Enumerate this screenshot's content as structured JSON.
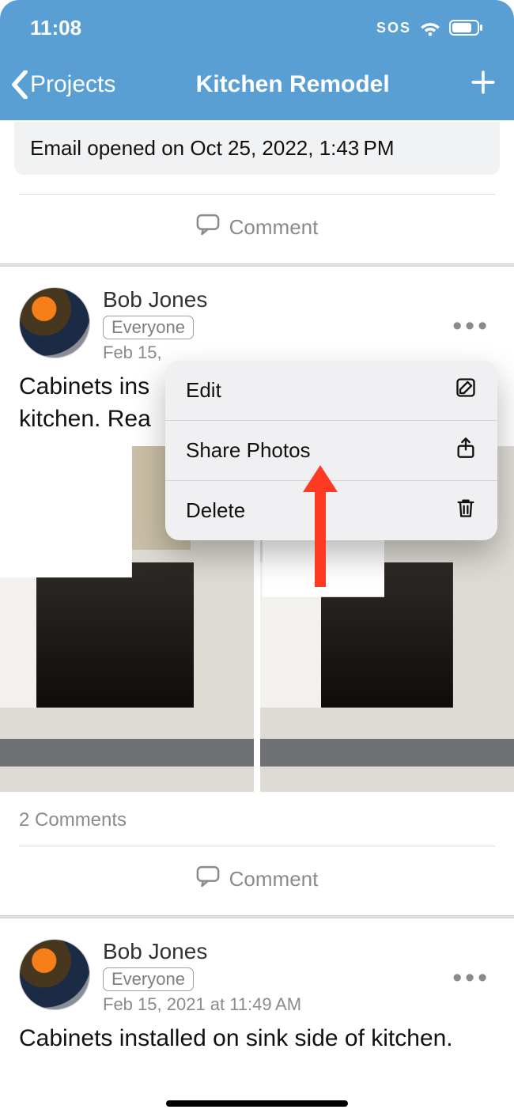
{
  "status_bar": {
    "time": "11:08",
    "sos": "SOS"
  },
  "nav": {
    "back_label": "Projects",
    "title": "Kitchen Remodel"
  },
  "email_card": {
    "text": "Email opened on Oct 25, 2022, 1:43 PM"
  },
  "comment_label": "Comment",
  "popover": {
    "items": [
      {
        "label": "Edit"
      },
      {
        "label": "Share Photos"
      },
      {
        "label": "Delete"
      }
    ]
  },
  "posts": [
    {
      "author": "Bob Jones",
      "visibility": "Everyone",
      "timestamp_partial": "Feb 15, ",
      "body_visible": "Cabinets ins\nkitchen. Rea",
      "comments_count": "2 Comments"
    },
    {
      "author": "Bob Jones",
      "visibility": "Everyone",
      "timestamp": "Feb 15, 2021 at 11:49 AM",
      "body": "Cabinets installed on sink side of kitchen."
    }
  ]
}
